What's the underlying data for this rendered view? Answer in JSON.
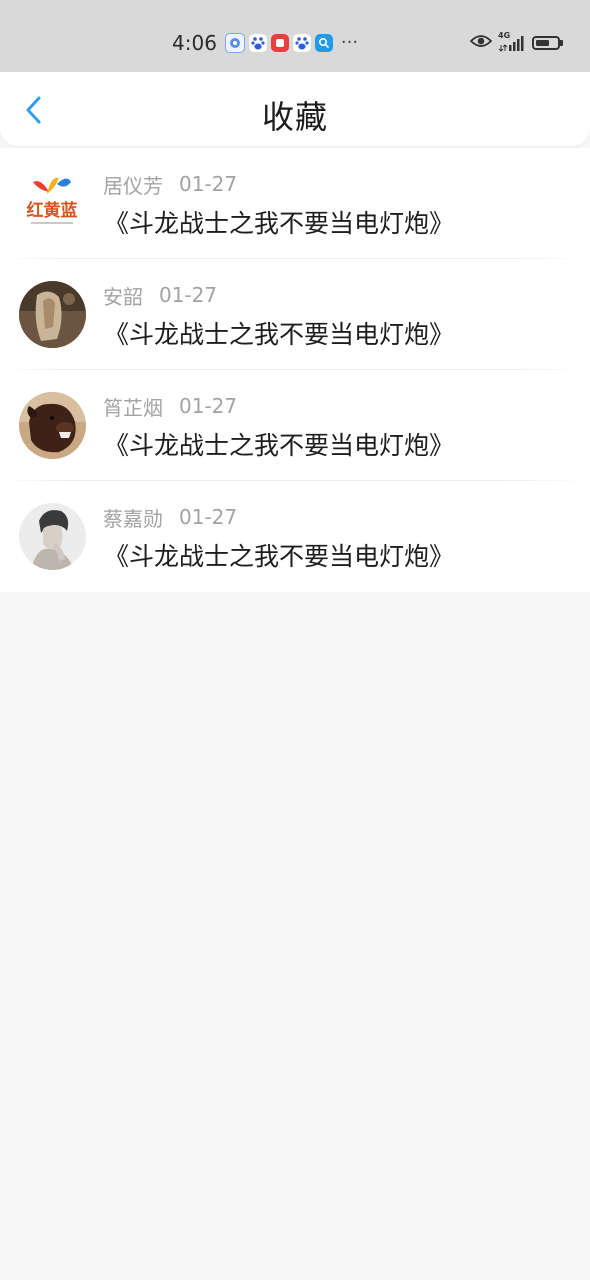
{
  "status_bar": {
    "time": "4:06",
    "more": "···",
    "network": "4G",
    "battery_level": 0.65,
    "notification_icons": [
      "music-app-icon",
      "baidu-paw-icon",
      "red-app-icon",
      "baidu-paw-icon",
      "search-app-icon"
    ]
  },
  "header": {
    "title": "收藏",
    "back_icon": "chevron-left-icon",
    "accent_color": "#2f9ef0"
  },
  "favorites": [
    {
      "name": "居仪芳",
      "date": "01-27",
      "title": "《斗龙战士之我不要当电灯炮》",
      "avatar": "logo-avatar",
      "avatar_text": "红黄蓝"
    },
    {
      "name": "安韶",
      "date": "01-27",
      "title": "《斗龙战士之我不要当电灯炮》",
      "avatar": "photo-avatar"
    },
    {
      "name": "筲芷烟",
      "date": "01-27",
      "title": "《斗龙战士之我不要当电灯炮》",
      "avatar": "dog-avatar"
    },
    {
      "name": "蔡嘉勋",
      "date": "01-27",
      "title": "《斗龙战士之我不要当电灯炮》",
      "avatar": "portrait-avatar"
    }
  ]
}
